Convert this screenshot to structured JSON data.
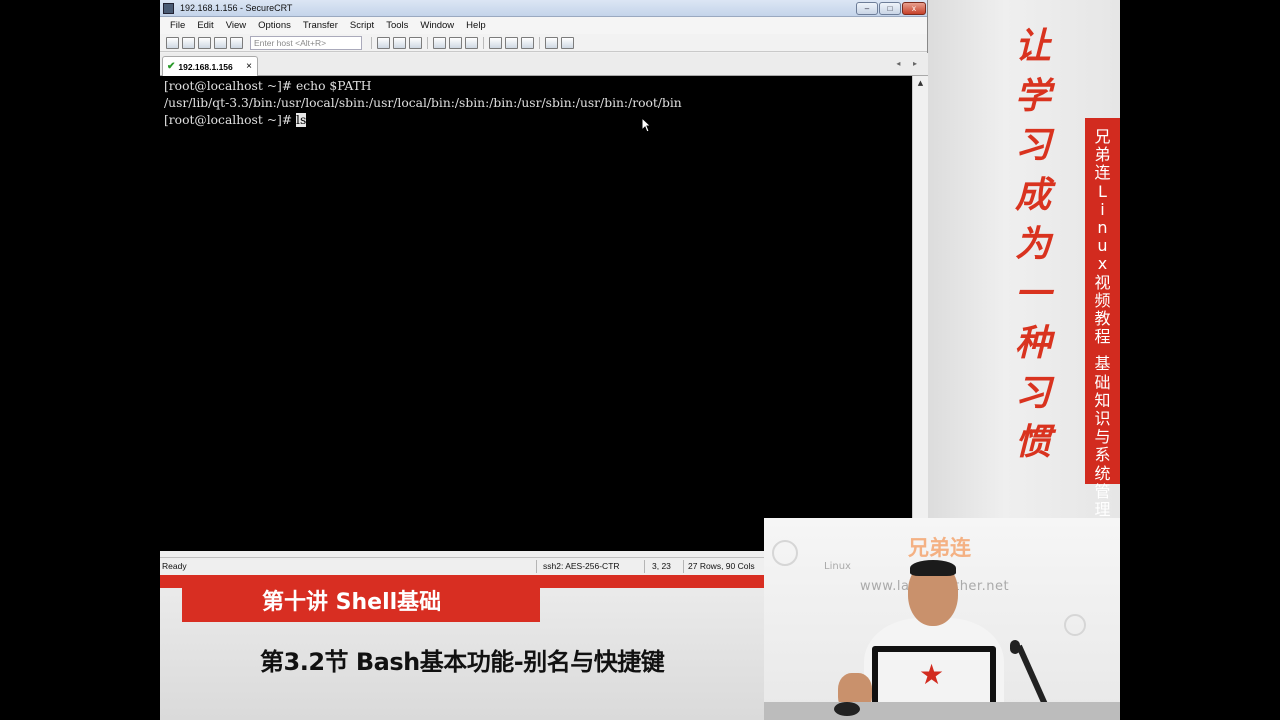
{
  "window": {
    "title": "192.168.1.156 - SecureCRT",
    "controls": {
      "minimize": "–",
      "maximize": "□",
      "close": "x"
    }
  },
  "menu": [
    "File",
    "Edit",
    "View",
    "Options",
    "Transfer",
    "Script",
    "Tools",
    "Window",
    "Help"
  ],
  "toolbar": {
    "host_placeholder": "Enter host <Alt+R>"
  },
  "tab": {
    "label": "192.168.1.156",
    "close": "×",
    "nav": "◂ ▸"
  },
  "terminal": {
    "line1": "[root@localhost ~]# echo $PATH",
    "line2": "/usr/lib/qt-3.3/bin:/usr/local/sbin:/usr/local/bin:/sbin:/bin:/usr/sbin:/usr/bin:/root/bin",
    "line3_prompt": "[root@localhost ~]# ",
    "line3_cmd": "ls"
  },
  "status": {
    "state": "Ready",
    "cipher": "ssh2: AES-256-CTR",
    "cursor_pos": "3,  23",
    "dims": "27 Rows, 90 Cols"
  },
  "sidebar": {
    "slogan": [
      "让",
      "学",
      "习",
      "成",
      "为",
      "一",
      "种",
      "习",
      "惯"
    ],
    "banner_top": [
      "兄",
      "弟",
      "连",
      "L",
      "i",
      "n",
      "u",
      "x",
      "视",
      "频",
      "教",
      "程"
    ],
    "banner_bottom": [
      "基",
      "础",
      "知",
      "识",
      "与",
      "系",
      "统",
      "管",
      "理"
    ]
  },
  "lecture": {
    "chapter": "第十讲 Shell基础",
    "section": "第3.2节 Bash基本功能-别名与快捷键"
  },
  "webcam": {
    "logo": "兄弟连",
    "linux": "Linux",
    "url": "www.lampbrother.net"
  }
}
